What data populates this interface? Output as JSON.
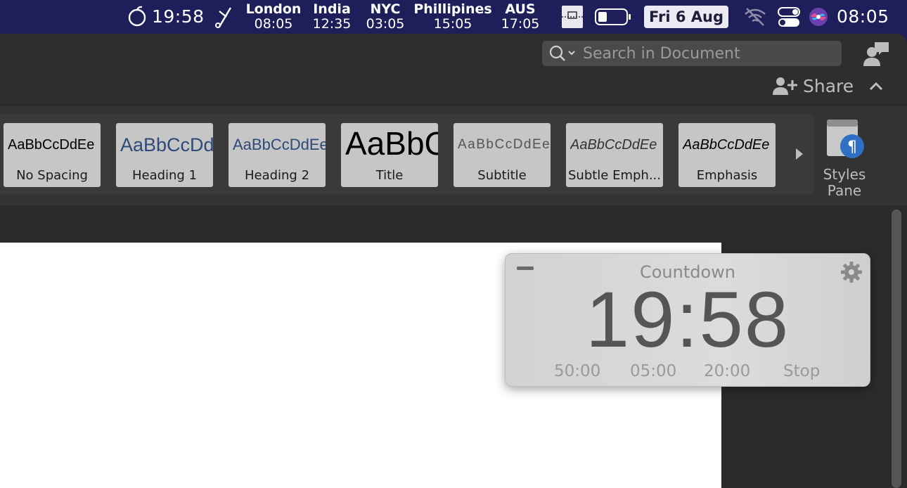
{
  "menubar": {
    "timer_time": "19:58",
    "world_clocks": [
      {
        "city": "London",
        "time": "08:05"
      },
      {
        "city": "India",
        "time": "12:35"
      },
      {
        "city": "NYC",
        "time": "03:05"
      },
      {
        "city": "Phillipines",
        "time": "15:05"
      },
      {
        "city": "AUS",
        "time": "17:05"
      }
    ],
    "date": "Fri 6 Aug",
    "clock": "08:05"
  },
  "toolbar": {
    "search_placeholder": "Search in Document",
    "share_label": "Share"
  },
  "styles_gallery": {
    "items": [
      {
        "sample": "AaBbCcDdEe",
        "label": "No Spacing"
      },
      {
        "sample": "AaBbCcDdEe",
        "label": "Heading 1"
      },
      {
        "sample": "AaBbCcDdEe",
        "label": "Heading 2"
      },
      {
        "sample": "AaBbCcDdEe",
        "label": "Title"
      },
      {
        "sample": "AaBbCcDdEe",
        "label": "Subtitle"
      },
      {
        "sample": "AaBbCcDdEe",
        "label": "Subtle Emph..."
      },
      {
        "sample": "AaBbCcDdEe",
        "label": "Emphasis"
      }
    ],
    "styles_pane_label_1": "Styles",
    "styles_pane_label_2": "Pane"
  },
  "countdown": {
    "title": "Countdown",
    "time": "19:58",
    "presets": [
      "50:00",
      "05:00",
      "20:00"
    ],
    "stop_label": "Stop"
  },
  "colors": {
    "menubar_bg": "#1e1f5a",
    "ribbon_bg": "#333333",
    "styles_pane_badge": "#2f6fc4"
  }
}
